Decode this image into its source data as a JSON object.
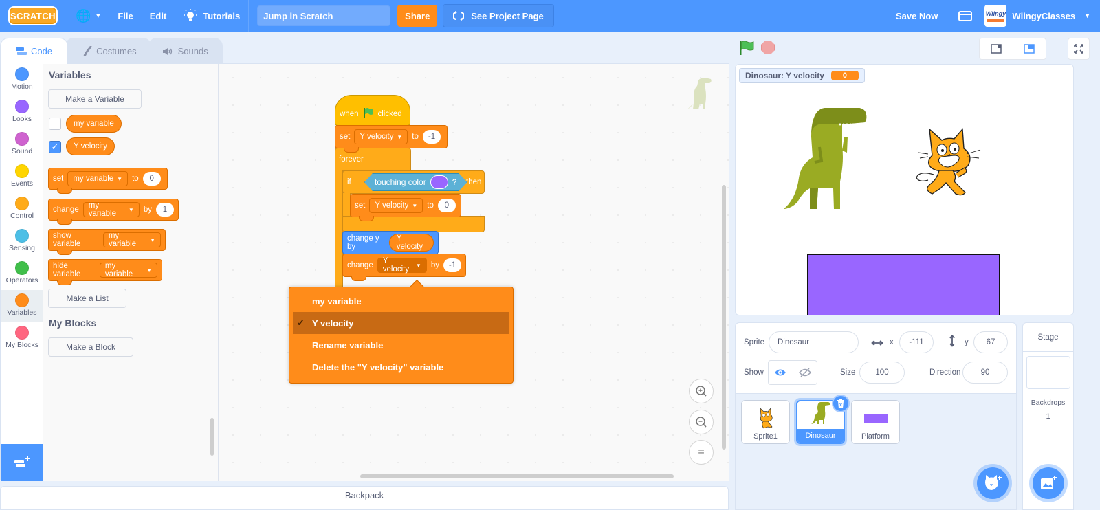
{
  "menubar": {
    "logo": "SCRATCH",
    "file": "File",
    "edit": "Edit",
    "tutorials": "Tutorials",
    "project_title": "Jump in Scratch",
    "share": "Share",
    "see_project_page": "See Project Page",
    "save_now": "Save Now",
    "username": "WiingyClasses",
    "avatar_text": "Wiingy"
  },
  "tabs": [
    {
      "label": "Code",
      "active": true
    },
    {
      "label": "Costumes",
      "active": false
    },
    {
      "label": "Sounds",
      "active": false
    }
  ],
  "categories": [
    {
      "label": "Motion",
      "color": "#4c97ff"
    },
    {
      "label": "Looks",
      "color": "#9966ff"
    },
    {
      "label": "Sound",
      "color": "#cf63cf"
    },
    {
      "label": "Events",
      "color": "#ffd500"
    },
    {
      "label": "Control",
      "color": "#ffab19"
    },
    {
      "label": "Sensing",
      "color": "#4cbfe6"
    },
    {
      "label": "Operators",
      "color": "#40bf4a"
    },
    {
      "label": "Variables",
      "color": "#ff8c1a",
      "active": true
    },
    {
      "label": "My Blocks",
      "color": "#ff6680"
    }
  ],
  "palette": {
    "variables_heading": "Variables",
    "make_variable": "Make a Variable",
    "variables": [
      {
        "name": "my variable",
        "checked": false
      },
      {
        "name": "Y velocity",
        "checked": true
      }
    ],
    "set_block": {
      "word": "set",
      "var": "my variable",
      "to": "to",
      "value": "0"
    },
    "change_block": {
      "word": "change",
      "var": "my variable",
      "by": "by",
      "value": "1"
    },
    "show_block": {
      "word": "show variable",
      "var": "my variable"
    },
    "hide_block": {
      "word": "hide variable",
      "var": "my variable"
    },
    "make_list": "Make a List",
    "my_blocks_heading": "My Blocks",
    "make_block": "Make a Block"
  },
  "script": {
    "when": "when",
    "clicked": "clicked",
    "set1": {
      "word": "set",
      "var": "Y velocity",
      "to": "to",
      "value": "-1"
    },
    "forever": "forever",
    "if": "if",
    "touching": "touching color",
    "touching_q": "?",
    "touching_color": "#9966ff",
    "then": "then",
    "set2": {
      "word": "set",
      "var": "Y velocity",
      "to": "to",
      "value": "0"
    },
    "change_y": "change y by",
    "change_y_var": "Y velocity",
    "change": {
      "word": "change",
      "var": "Y velocity",
      "by": "by",
      "value": "-1"
    }
  },
  "dropdown_menu": {
    "items": [
      {
        "label": "my variable",
        "selected": false
      },
      {
        "label": "Y velocity",
        "selected": true
      },
      {
        "label": "Rename variable",
        "selected": false
      },
      {
        "label": "Delete the \"Y velocity\" variable",
        "selected": false
      }
    ],
    "check": "✓"
  },
  "zoom_controls": {
    "zoom_in": "+",
    "zoom_out": "−",
    "reset": "="
  },
  "backpack": "Backpack",
  "stage": {
    "monitor_label": "Dinosaur: Y velocity",
    "monitor_value": "0"
  },
  "sprite_info": {
    "sprite_label": "Sprite",
    "sprite_name": "Dinosaur",
    "x_label": "x",
    "x_value": "-111",
    "y_label": "y",
    "y_value": "67",
    "show_label": "Show",
    "size_label": "Size",
    "size_value": "100",
    "direction_label": "Direction",
    "direction_value": "90"
  },
  "sprites": [
    {
      "name": "Sprite1",
      "selected": false
    },
    {
      "name": "Dinosaur",
      "selected": true
    },
    {
      "name": "Platform",
      "selected": false
    }
  ],
  "stage_pane": {
    "title": "Stage",
    "backdrops_label": "Backdrops",
    "backdrops_count": "1"
  }
}
